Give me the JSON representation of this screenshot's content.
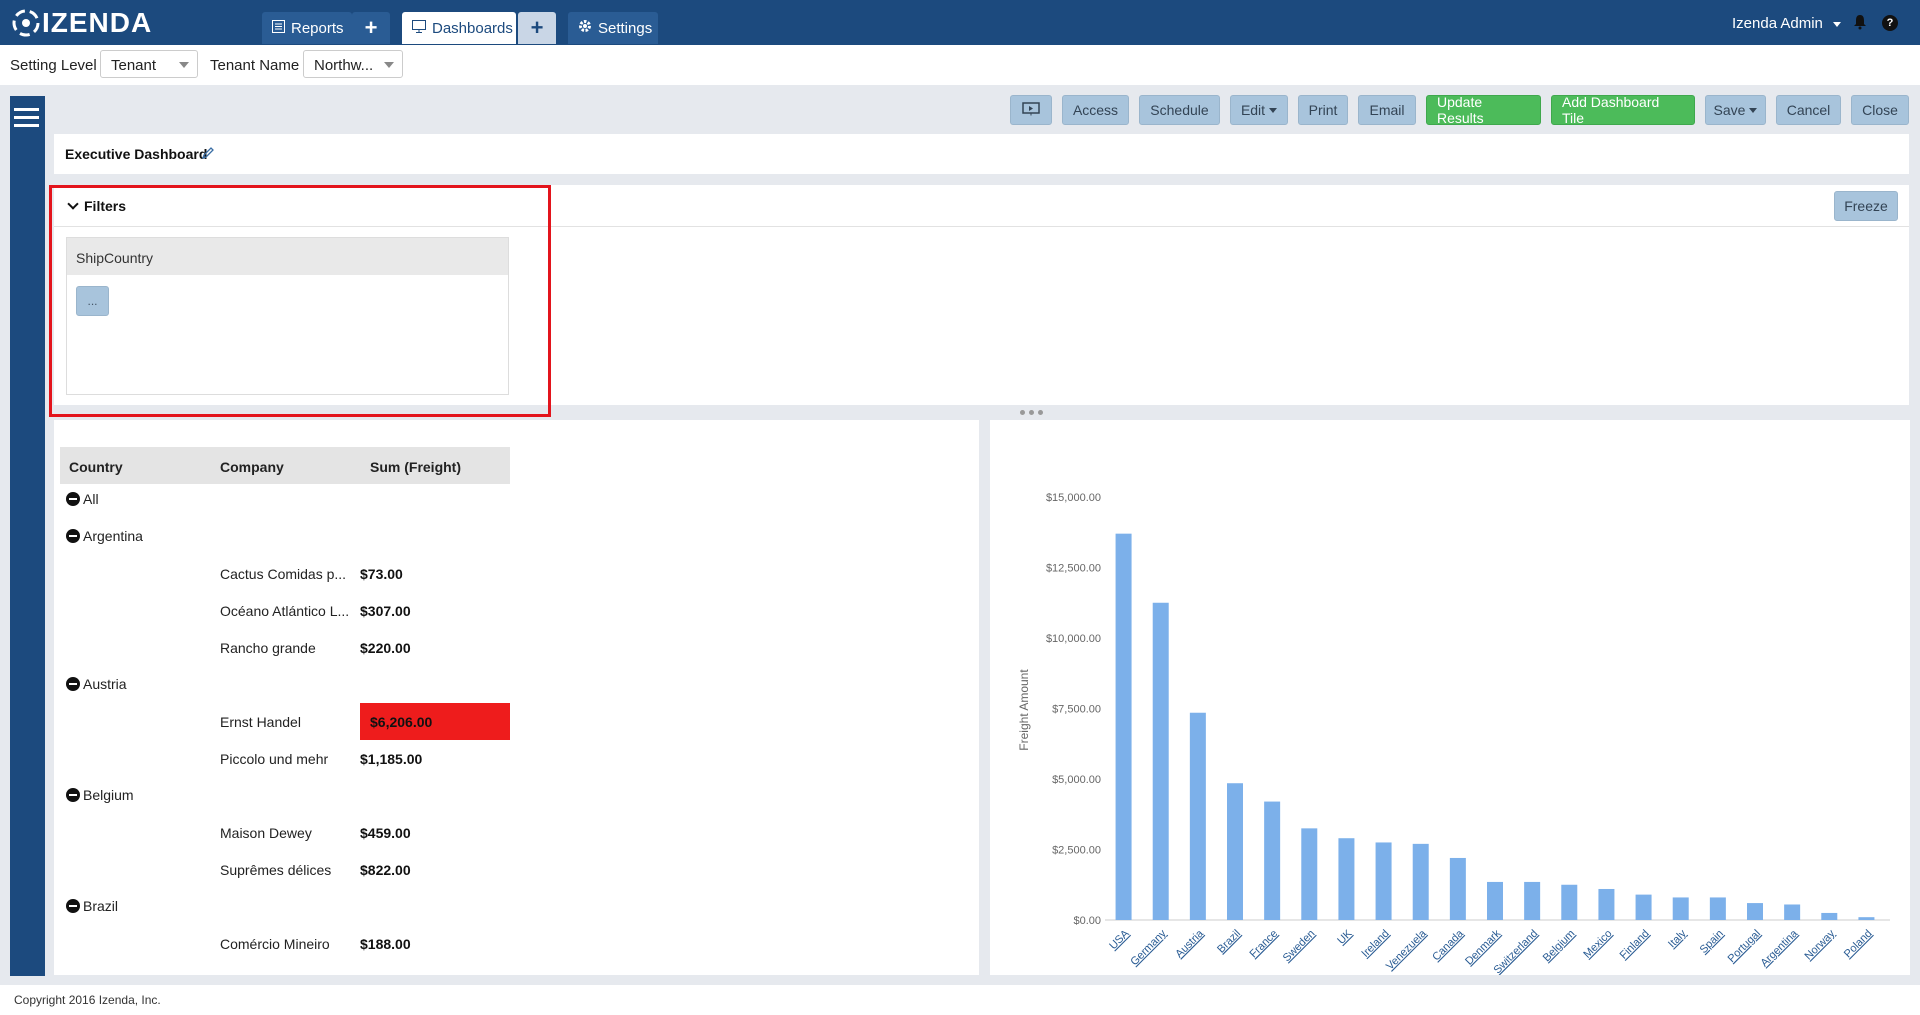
{
  "brand": {
    "logo_text": "IZENDA"
  },
  "nav": {
    "reports_label": "Reports",
    "dashboards_label": "Dashboards",
    "settings_label": "Settings",
    "user_label": "Izenda Admin",
    "help_label": "?"
  },
  "settings": {
    "setting_level_label": "Setting Level",
    "setting_level_value": "Tenant",
    "tenant_name_label": "Tenant Name",
    "tenant_name_value": "Northw..."
  },
  "toolbar": {
    "access": "Access",
    "schedule": "Schedule",
    "edit": "Edit",
    "print": "Print",
    "email": "Email",
    "update_results": "Update Results",
    "add_tile": "Add Dashboard Tile",
    "save": "Save",
    "cancel": "Cancel",
    "close": "Close"
  },
  "dashboard": {
    "title": "Executive Dashboard"
  },
  "filters": {
    "title": "Filters",
    "freeze_label": "Freeze",
    "field_name": "ShipCountry",
    "picker_label": "..."
  },
  "table": {
    "headers": [
      "Country",
      "Company",
      "Sum (Freight)"
    ],
    "all_label": "All",
    "groups": [
      {
        "country": "Argentina",
        "rows": [
          {
            "company": "Cactus Comidas p...",
            "amount": "$73.00"
          },
          {
            "company": "Océano Atlántico L...",
            "amount": "$307.00"
          },
          {
            "company": "Rancho grande",
            "amount": "$220.00"
          }
        ]
      },
      {
        "country": "Austria",
        "rows": [
          {
            "company": "Ernst Handel",
            "amount": "$6,206.00",
            "highlight": true
          },
          {
            "company": "Piccolo und mehr",
            "amount": "$1,185.00"
          }
        ]
      },
      {
        "country": "Belgium",
        "rows": [
          {
            "company": "Maison Dewey",
            "amount": "$459.00"
          },
          {
            "company": "Suprêmes délices",
            "amount": "$822.00"
          }
        ]
      },
      {
        "country": "Brazil",
        "rows": [
          {
            "company": "Comércio Mineiro",
            "amount": "$188.00"
          }
        ]
      }
    ]
  },
  "colors": {
    "nav_bg": "#1c4a7e",
    "button_bg": "#a8c4dc",
    "green": "#4cbb5a",
    "highlight_red": "#ee1c1c",
    "bar": "#7cb0ea"
  },
  "chart_data": {
    "type": "bar",
    "title": "",
    "xlabel": "",
    "ylabel": "Freight Amount",
    "ylim": [
      0,
      15000
    ],
    "yticks": [
      "$0.00",
      "$2,500.00",
      "$5,000.00",
      "$7,500.00",
      "$10,000.00",
      "$12,500.00",
      "$15,000.00"
    ],
    "categories": [
      "USA",
      "Germany",
      "Austria",
      "Brazil",
      "France",
      "Sweden",
      "UK",
      "Ireland",
      "Venezuela",
      "Canada",
      "Denmark",
      "Switzerland",
      "Belgium",
      "Mexico",
      "Finland",
      "Italy",
      "Spain",
      "Portugal",
      "Argentina",
      "Norway",
      "Poland"
    ],
    "values": [
      13700,
      11250,
      7350,
      4850,
      4200,
      3250,
      2900,
      2750,
      2700,
      2200,
      1350,
      1350,
      1250,
      1100,
      900,
      800,
      800,
      600,
      550,
      250,
      100
    ]
  },
  "footer": {
    "copyright": "Copyright 2016 Izenda, Inc."
  }
}
